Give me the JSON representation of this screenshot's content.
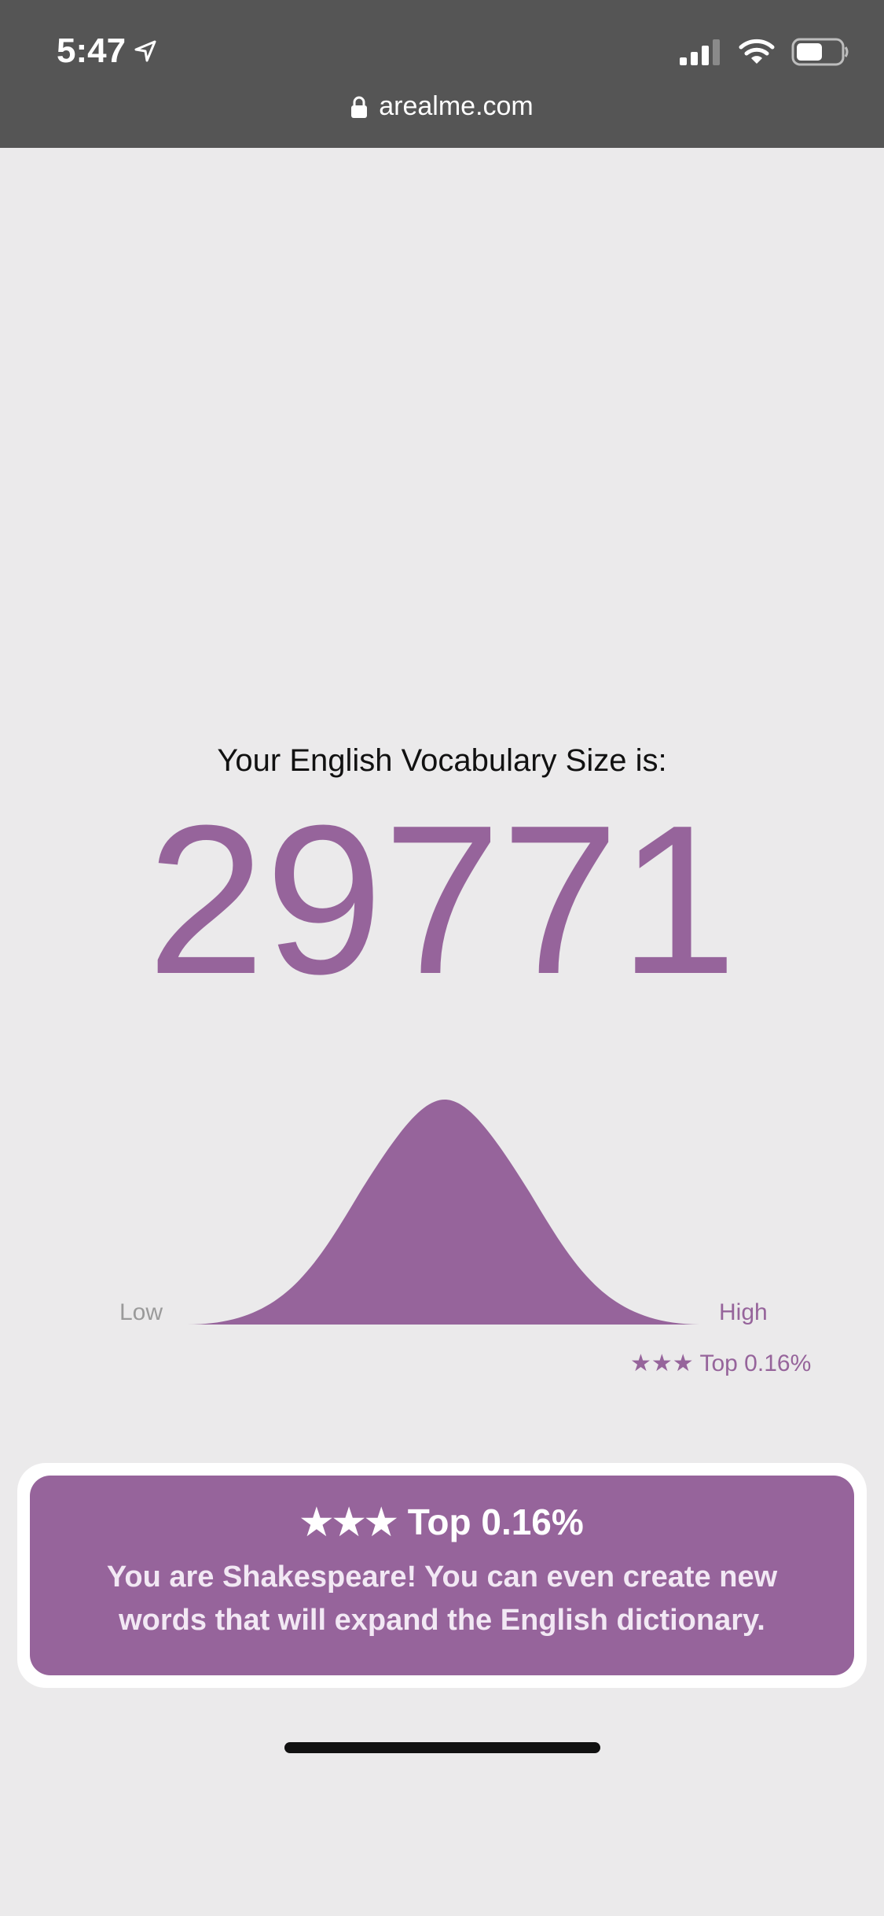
{
  "status_bar": {
    "time": "5:47",
    "url": "arealme.com"
  },
  "result": {
    "heading": "Your English Vocabulary Size is:",
    "score": "29771",
    "chart": {
      "low_label": "Low",
      "high_label": "High",
      "rank_label": "★★★ Top 0.16%"
    },
    "box": {
      "title": "★★★ Top 0.16%",
      "description": "You are Shakespeare! You can even create new words that will expand the English dictionary."
    }
  },
  "colors": {
    "accent": "#96649b",
    "status_bar": "#555555",
    "background": "#ebeaeb"
  }
}
